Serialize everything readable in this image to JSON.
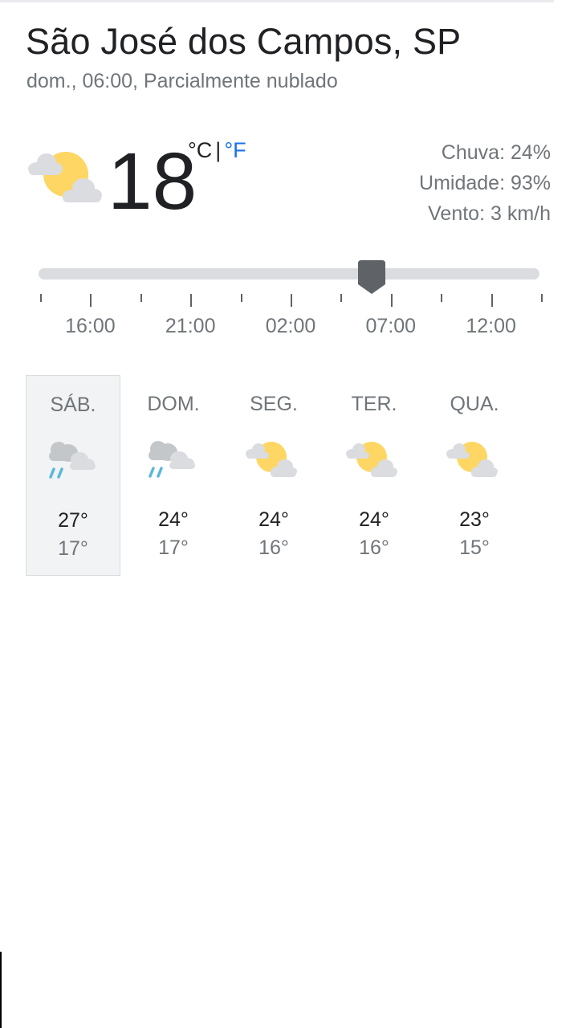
{
  "header": {
    "location": "São José dos Campos, SP",
    "summary": "dom., 06:00, Parcialmente nublado"
  },
  "current": {
    "temperature": "18",
    "unit_celsius": "°C",
    "unit_separator": "|",
    "unit_fahrenheit": "°F",
    "icon": "partly-cloudy-icon",
    "details": {
      "rain": "Chuva: 24%",
      "humidity": "Umidade: 93%",
      "wind": "Vento: 3 km/h"
    }
  },
  "timeline": {
    "labels": [
      "16:00",
      "21:00",
      "02:00",
      "07:00",
      "12:00"
    ],
    "selected_fraction": 0.667
  },
  "forecast": [
    {
      "day": "SÁB.",
      "icon": "rain-icon",
      "high": "27°",
      "low": "17°",
      "selected": true
    },
    {
      "day": "DOM.",
      "icon": "rain-icon",
      "high": "24°",
      "low": "17°",
      "selected": false
    },
    {
      "day": "SEG.",
      "icon": "partly-cloudy-icon",
      "high": "24°",
      "low": "16°",
      "selected": false
    },
    {
      "day": "TER.",
      "icon": "partly-cloudy-icon",
      "high": "24°",
      "low": "16°",
      "selected": false
    },
    {
      "day": "QUA.",
      "icon": "partly-cloudy-icon",
      "high": "23°",
      "low": "15°",
      "selected": false
    }
  ],
  "colors": {
    "sun": "#fdd663",
    "cloud": "#dadce0",
    "rain": "#5bb8d8",
    "link": "#1a73e8",
    "thumb": "#5f6368"
  }
}
